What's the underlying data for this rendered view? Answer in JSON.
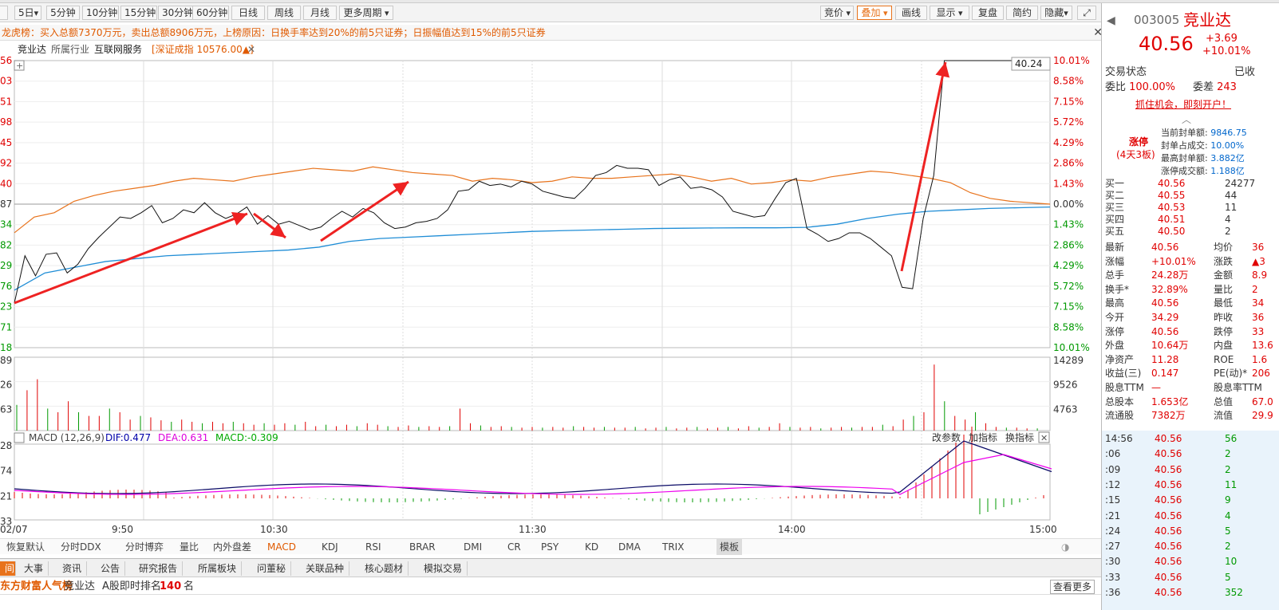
{
  "toolbar": {
    "items": [
      "5日",
      "5分钟",
      "10分钟",
      "15分钟",
      "30分钟",
      "60分钟",
      "日线",
      "周线",
      "月线",
      "更多周期"
    ],
    "right": [
      "竞价",
      "叠加",
      "画线",
      "显示",
      "复盘",
      "简约",
      "隐藏"
    ]
  },
  "banner": {
    "text": "龙虎榜：买入总额7370万元，卖出总额8906万元，上榜原因：日换手率达到20%的前5只证券；日振幅值达到15%的前5只证券"
  },
  "stock": {
    "name": "竞业达",
    "industry_label": "所属行业",
    "industry": "互联网服务",
    "index": "[深证成指 10576.00▲]",
    "price_tag": "40.24"
  },
  "chart_data": {
    "type": "line",
    "left_price_ticks": [
      "56",
      "03",
      "51",
      "98",
      "45",
      "92",
      "40",
      "87",
      "34",
      "82",
      "29",
      "76",
      "23",
      "71",
      "18"
    ],
    "pct_ticks": [
      "10.01%",
      "8.58%",
      "7.15%",
      "5.72%",
      "4.29%",
      "2.86%",
      "1.43%",
      "0.00%",
      "1.43%",
      "2.86%",
      "4.29%",
      "5.72%",
      "7.15%",
      "8.58%",
      "10.01%"
    ],
    "vol_left": [
      "89",
      "26",
      "63"
    ],
    "vol_right": [
      "14289",
      "9526",
      "4763"
    ],
    "macd_left": [
      "28",
      "74",
      "21",
      "33"
    ],
    "time_labels": [
      "02/07",
      "9:50",
      "10:30",
      "11:30",
      "14:00",
      "15:00"
    ],
    "macd": {
      "label": "MACD (12,26,9)",
      "dif": "DIF:0.477",
      "dea": "DEA:0.631",
      "macd": "MACD:-0.309",
      "btn1": "改参数",
      "btn2": "加指标",
      "btn3": "换指标"
    },
    "prev_close_pct": 0.0,
    "limit_up_pct": 10.01,
    "price_pct": [
      -6.9,
      -3.6,
      -5.0,
      -3.5,
      -3.4,
      -4.8,
      -4.2,
      -3.1,
      -2.3,
      -1.6,
      -0.9,
      -1.0,
      -0.6,
      -0.1,
      -1.3,
      -1.0,
      -0.4,
      -0.6,
      0.1,
      -0.6,
      -1.0,
      -0.7,
      -0.2,
      -1.4,
      -0.8,
      -1.4,
      -1.2,
      -1.5,
      -1.8,
      -1.6,
      -1.0,
      -0.5,
      -0.9,
      -0.3,
      -0.6,
      -1.3,
      -1.7,
      -1.6,
      -1.3,
      -1.2,
      -1.0,
      -0.4,
      0.9,
      1.0,
      1.6,
      1.3,
      1.4,
      1.2,
      1.6,
      1.4,
      0.9,
      0.7,
      0.5,
      0.4,
      1.1,
      2.0,
      2.2,
      2.7,
      2.5,
      2.5,
      2.4,
      1.3,
      1.7,
      1.9,
      1.1,
      1.2,
      1.0,
      0.5,
      -0.5,
      -0.7,
      -0.9,
      -0.8,
      0.4,
      1.5,
      1.8,
      -1.7,
      -2.1,
      -2.6,
      -2.4,
      -2.0,
      -2.0,
      -2.4,
      -3.0,
      -3.6,
      -5.8,
      -5.9,
      -1.0,
      2.0,
      10.01,
      10.01,
      10.01,
      10.01,
      10.01,
      10.01,
      10.01,
      10.01,
      10.01,
      10.01,
      10.01
    ],
    "avg_pct": [
      -2.0,
      -0.9,
      -0.6,
      0.2,
      0.6,
      0.9,
      1.1,
      1.3,
      1.6,
      1.8,
      1.7,
      1.6,
      1.9,
      2.1,
      2.3,
      2.5,
      2.4,
      2.3,
      2.6,
      2.4,
      2.2,
      2.1,
      2.0,
      1.6,
      1.8,
      1.7,
      1.5,
      1.6,
      1.9,
      1.8,
      1.8,
      1.9,
      2.0,
      2.1,
      1.9,
      1.6,
      1.8,
      1.4,
      1.5,
      1.7,
      1.6,
      1.9,
      2.1,
      2.3,
      2.2,
      2.0,
      1.8,
      1.5,
      0.8,
      0.4,
      0.2,
      0.1,
      0.0
    ],
    "vol_heights": [
      0.35,
      0.55,
      0.7,
      0.3,
      0.25,
      0.4,
      0.25,
      0.2,
      0.2,
      0.3,
      0.25,
      0.15,
      0.2,
      0.18,
      0.14,
      0.12,
      0.15,
      0.12,
      0.1,
      0.12,
      0.1,
      0.12,
      0.1,
      0.08,
      0.1,
      0.08,
      0.1,
      0.08,
      0.12,
      0.06,
      0.08,
      0.06,
      0.08,
      0.06,
      0.1,
      0.08,
      0.06,
      0.05,
      0.07,
      0.05,
      0.06,
      0.05,
      0.06,
      0.3,
      0.1,
      0.07,
      0.05,
      0.06,
      0.05,
      0.04,
      0.05,
      0.04,
      0.05,
      0.04,
      0.06,
      0.05,
      0.04,
      0.05,
      0.04,
      0.04,
      0.05,
      0.03,
      0.04,
      0.05,
      0.03,
      0.04,
      0.05,
      0.03,
      0.04,
      0.05,
      0.03,
      0.06,
      0.04,
      0.05,
      0.1,
      0.05,
      0.04,
      0.05,
      0.03,
      0.04,
      0.05,
      0.04,
      0.05,
      0.05,
      0.08,
      0.06,
      0.15,
      0.2,
      0.25,
      0.9,
      0.4,
      0.2,
      0.15,
      0.25,
      0.1,
      0.05,
      0.04,
      0.04,
      0.03,
      0.03
    ]
  },
  "indicators": [
    "恢复默认",
    "分时DDX",
    "分时博弈",
    "量比",
    "内外盘差",
    "MACD",
    "KDJ",
    "RSI",
    "BRAR",
    "DMI",
    "CR",
    "PSY",
    "KD",
    "DMA",
    "TRIX",
    "模板"
  ],
  "bottom_tabs": [
    "大事",
    "资讯",
    "公告",
    "研究报告",
    "所属板块",
    "问董秘",
    "关联品种",
    "核心题材",
    "模拟交易"
  ],
  "bottom_line": {
    "title": "东方财富人气榜",
    "name": "竞业达",
    "rank_label": "A股即时排名",
    "rank": "140",
    "unit": "名",
    "more": "查看更多"
  },
  "right_panel": {
    "code": "003005",
    "name": "竞业达",
    "price": "40.56",
    "change": "+3.69",
    "pct": "+10.01%",
    "status_label": "交易状态",
    "status": "已收",
    "weibi_label": "委比",
    "weibi": "100.00%",
    "weicha_label": "委差",
    "weicha": "243",
    "promo": "抓住机会，即刻开户！",
    "limit": "涨停",
    "limit_sub": "(4天3板)",
    "seal": [
      [
        "当前封单额:",
        "9846.75"
      ],
      [
        "封单占成交:",
        "10.00%"
      ],
      [
        "最高封单额:",
        "3.882亿"
      ],
      [
        "涨停成交额:",
        "1.188亿"
      ]
    ],
    "bids": [
      [
        "买一",
        "40.56",
        "24277"
      ],
      [
        "买二",
        "40.55",
        "44"
      ],
      [
        "买三",
        "40.53",
        "11"
      ],
      [
        "买四",
        "40.51",
        "4"
      ],
      [
        "买五",
        "40.50",
        "2"
      ]
    ],
    "stats": [
      [
        "最新",
        "40.56",
        "均价",
        "36"
      ],
      [
        "涨幅",
        "+10.01%",
        "涨跌",
        "▲3"
      ],
      [
        "总手",
        "24.28万",
        "金额",
        "8.9"
      ],
      [
        "换手*",
        "32.89%",
        "量比",
        "2"
      ],
      [
        "最高",
        "40.56",
        "最低",
        "34"
      ],
      [
        "今开",
        "34.29",
        "昨收",
        "36"
      ],
      [
        "涨停",
        "40.56",
        "跌停",
        "33"
      ],
      [
        "外盘",
        "10.64万",
        "内盘",
        "13.6"
      ],
      [
        "净资产",
        "11.28",
        "ROE",
        "1.6"
      ],
      [
        "收益(三)",
        "0.147",
        "PE(动)*",
        "206"
      ],
      [
        "股息TTM",
        "—",
        "股息率TTM",
        ""
      ],
      [
        "总股本",
        "1.653亿",
        "总值",
        "67.0"
      ],
      [
        "流通股",
        "7382万",
        "流值",
        "29.9"
      ]
    ],
    "ticks": [
      [
        "14:56",
        "40.56",
        "56"
      ],
      [
        ":06",
        "40.56",
        "2"
      ],
      [
        ":09",
        "40.56",
        "2"
      ],
      [
        ":12",
        "40.56",
        "11"
      ],
      [
        ":15",
        "40.56",
        "9"
      ],
      [
        ":21",
        "40.56",
        "4"
      ],
      [
        ":24",
        "40.56",
        "5"
      ],
      [
        ":27",
        "40.56",
        "2"
      ],
      [
        ":30",
        "40.56",
        "10"
      ],
      [
        ":33",
        "40.56",
        "5"
      ],
      [
        ":36",
        "40.56",
        "352"
      ]
    ]
  }
}
